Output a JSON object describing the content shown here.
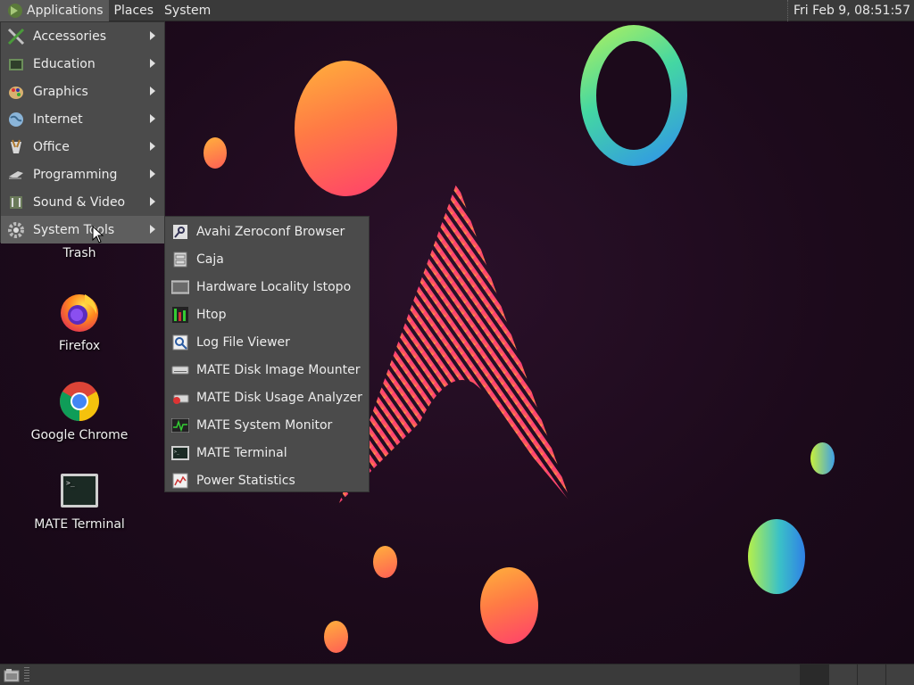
{
  "top_panel": {
    "menus": [
      "Applications",
      "Places",
      "System"
    ],
    "clock": "Fri Feb  9, 08:51:57"
  },
  "applications_menu": {
    "items": [
      {
        "label": "Accessories",
        "icon": "accessories-icon"
      },
      {
        "label": "Education",
        "icon": "education-icon"
      },
      {
        "label": "Graphics",
        "icon": "graphics-icon"
      },
      {
        "label": "Internet",
        "icon": "internet-icon"
      },
      {
        "label": "Office",
        "icon": "office-icon"
      },
      {
        "label": "Programming",
        "icon": "programming-icon"
      },
      {
        "label": "Sound & Video",
        "icon": "sound-video-icon"
      },
      {
        "label": "System Tools",
        "icon": "system-tools-icon",
        "active": true
      }
    ]
  },
  "system_tools_submenu": {
    "items": [
      {
        "label": "Avahi Zeroconf Browser",
        "icon": "avahi-icon"
      },
      {
        "label": "Caja",
        "icon": "caja-icon"
      },
      {
        "label": "Hardware Locality lstopo",
        "icon": "lstopo-icon"
      },
      {
        "label": "Htop",
        "icon": "htop-icon"
      },
      {
        "label": "Log File Viewer",
        "icon": "log-viewer-icon"
      },
      {
        "label": "MATE Disk Image Mounter",
        "icon": "disk-mounter-icon"
      },
      {
        "label": "MATE Disk Usage Analyzer",
        "icon": "disk-usage-icon"
      },
      {
        "label": "MATE System Monitor",
        "icon": "system-monitor-icon"
      },
      {
        "label": "MATE Terminal",
        "icon": "terminal-icon"
      },
      {
        "label": "Power Statistics",
        "icon": "power-statistics-icon"
      }
    ]
  },
  "desktop_icons": [
    {
      "label": "Trash",
      "icon": "trash-icon"
    },
    {
      "label": "Firefox",
      "icon": "firefox-icon"
    },
    {
      "label": "Google Chrome",
      "icon": "chrome-icon"
    },
    {
      "label": "MATE Terminal",
      "icon": "terminal-icon"
    }
  ],
  "colors": {
    "panel_bg": "#3a3a3a",
    "menu_bg": "#4b4b4b",
    "menu_active": "#5e5e5e",
    "desktop_bg": "#1e0b1d",
    "accent_pink": "#ff3f6c",
    "accent_orange": "#ffb13b"
  }
}
